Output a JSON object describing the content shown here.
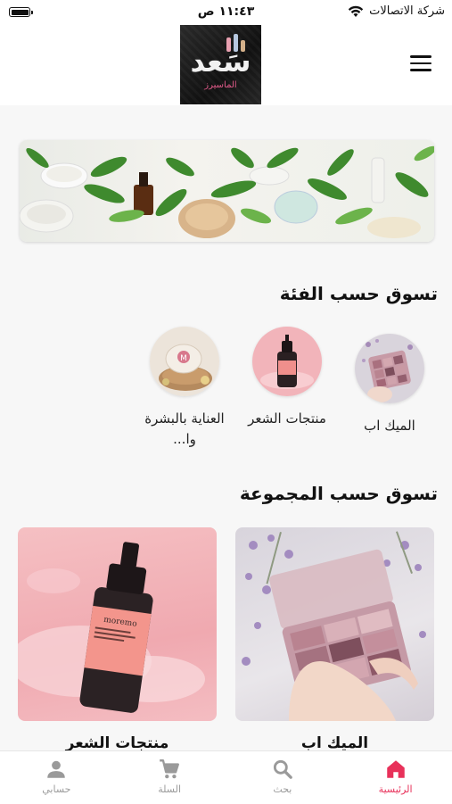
{
  "status_bar": {
    "carrier": "شركة الاتصالات",
    "time": "١١:٤٣ ص"
  },
  "header": {
    "logo_text": "سَعد",
    "logo_subtext": "الماسيرز",
    "menu_icon": "hamburger-menu-icon"
  },
  "hero": {
    "image": "skincare-products-with-green-leaves"
  },
  "shop_by_category": {
    "title": "تسوق حسب الفئة",
    "items": [
      {
        "label": "الميك اب",
        "image": "eyeshadow-palette"
      },
      {
        "label": "منتجات الشعر",
        "image": "hair-product-bottle"
      },
      {
        "label": "العناية بالبشرة وا...",
        "image": "skincare-jar"
      }
    ]
  },
  "shop_by_collection": {
    "title": "تسوق حسب المجموعة",
    "items": [
      {
        "label": "الميك اب",
        "image": "eyeshadow-palette-in-hand"
      },
      {
        "label": "منتجات الشعر",
        "image": "moremo-hair-treatment-bottle"
      }
    ],
    "product_brand": "moremo"
  },
  "tab_bar": {
    "items": [
      {
        "label": "الرئيسية",
        "icon": "home-icon",
        "active": true
      },
      {
        "label": "بحث",
        "icon": "search-icon",
        "active": false
      },
      {
        "label": "السلة",
        "icon": "cart-icon",
        "active": false
      },
      {
        "label": "حسابي",
        "icon": "user-icon",
        "active": false
      }
    ]
  },
  "colors": {
    "accent": "#e8315a",
    "inactive": "#9a9a9a",
    "background": "#f7f7f7"
  }
}
